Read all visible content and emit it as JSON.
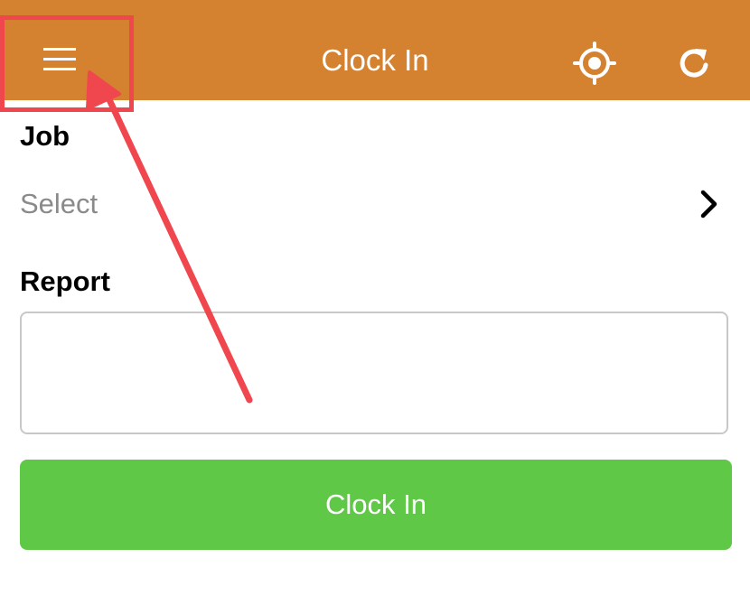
{
  "header": {
    "title": "Clock In",
    "menu_icon": "hamburger-menu-icon",
    "locate_icon": "crosshair-target-icon",
    "refresh_icon": "refresh-icon",
    "background_color": "#d4822f"
  },
  "job": {
    "label": "Job",
    "placeholder": "Select",
    "chevron_icon": "chevron-right-icon"
  },
  "report": {
    "label": "Report",
    "value": ""
  },
  "clock_in_button": {
    "label": "Clock In",
    "color": "#5fc847"
  },
  "annotation": {
    "color": "#f0474f"
  }
}
